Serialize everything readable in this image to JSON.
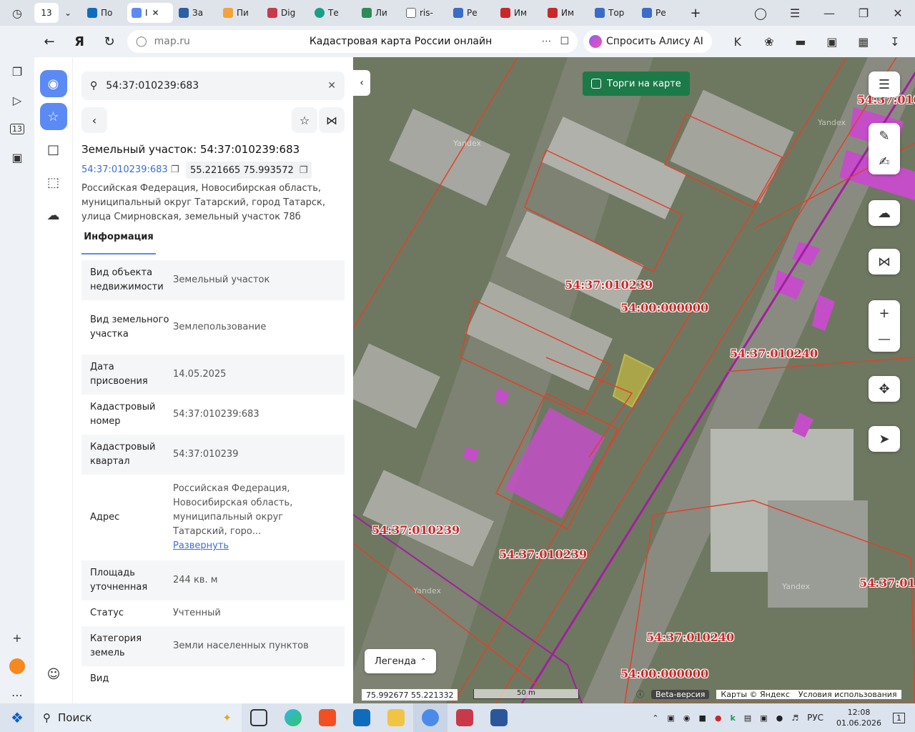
{
  "browser": {
    "tabs": [
      {
        "label": "13",
        "color": "#ffffff",
        "active": false
      },
      {
        "label": "По",
        "color": "#0f6cbd"
      },
      {
        "label": "I",
        "color": "#5b8af5",
        "active": true
      },
      {
        "label": "За",
        "color": "#2b5fa6"
      },
      {
        "label": "Пи",
        "color": "#f2a33a"
      },
      {
        "label": "Dig",
        "color": "#c83a4a"
      },
      {
        "label": "Те",
        "color": "#16a085"
      },
      {
        "label": "Ли",
        "color": "#2e8b57"
      },
      {
        "label": "ris-",
        "color": "#666666"
      },
      {
        "label": "Ре",
        "color": "#3a6cc8"
      },
      {
        "label": "Им",
        "color": "#c82828"
      },
      {
        "label": "Им",
        "color": "#c82828"
      },
      {
        "label": "Тор",
        "color": "#3a6cc8"
      },
      {
        "label": "Ре",
        "color": "#3a6cc8"
      }
    ],
    "url_host": "map.ru",
    "page_title": "Кадастровая карта России онлайн",
    "alice_label": "Спросить Алису AI",
    "rail_badge": "13"
  },
  "panel": {
    "search_query": "54:37:010239:683",
    "object_title": "Земельный участок: 54:37:010239:683",
    "cadastral_link": "54:37:010239:683",
    "coords": "55.221665 75.993572",
    "address": "Российская Федерация, Новосибирская область, муниципальный округ Татарский, город Татарск, улица Смирновская, земельный участок 78б",
    "tab_info": "Информация",
    "rows": [
      {
        "k": "Вид объекта недвижимости",
        "v": "Земельный участок"
      },
      {
        "k": "Вид земельного участка",
        "v": "Землепользование"
      },
      {
        "k": "Дата присвоения",
        "v": "14.05.2025"
      },
      {
        "k": "Кадастровый номер",
        "v": "54:37:010239:683"
      },
      {
        "k": "Кадастровый квартал",
        "v": "54:37:010239"
      },
      {
        "k": "Адрес",
        "v": "Российская Федерация, Новосибирская область, муниципальный округ Татарский, горо..."
      },
      {
        "k": "Площадь уточненная",
        "v": "244 кв. м"
      },
      {
        "k": "Статус",
        "v": "Учтенный"
      },
      {
        "k": "Категория земель",
        "v": "Земли населенных пунктов"
      },
      {
        "k": "Вид",
        "v": ""
      }
    ],
    "expand_label": "Развернуть"
  },
  "map": {
    "torgi_label": "Торги на карте",
    "labels": [
      {
        "text": "54:37:010239"
      },
      {
        "text": "54:00:000000"
      },
      {
        "text": "54:37:010240"
      },
      {
        "text": "54:37:010239"
      },
      {
        "text": "54:37:010239"
      },
      {
        "text": "54:37:010240"
      },
      {
        "text": "54:00:000000"
      },
      {
        "text": "54:37:01"
      },
      {
        "text": "54:37:010"
      }
    ],
    "legend_label": "Легенда",
    "coord_readout": "75.992677  55.221332",
    "scale_label": "50 m",
    "beta_label": "Beta-версия",
    "copyright": "Карты © Яндекс",
    "terms": "Условия использования",
    "watermark": "Yandex"
  },
  "taskbar": {
    "search_label": "Поиск",
    "lang": "РУС",
    "time": "12:08",
    "date": "01.06.2026",
    "notifications": "1"
  }
}
